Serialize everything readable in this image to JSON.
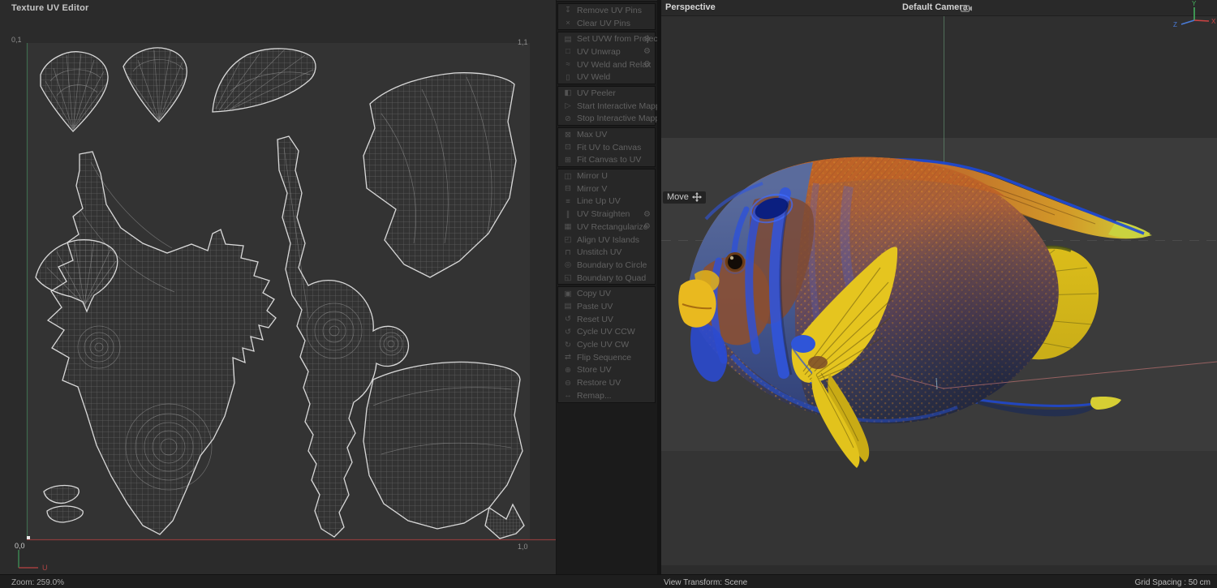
{
  "app": {
    "status_bar": {
      "zoom": "Zoom: 259.0%",
      "view_transform": "View Transform: Scene",
      "grid_spacing": "Grid Spacing : 50 cm"
    }
  },
  "uv_editor": {
    "title": "Texture UV Editor",
    "corners": {
      "top_left": "0,1",
      "top_right": "1,1",
      "bottom_left": "0,0",
      "bottom_right": "1,0"
    },
    "u_axis_label": "U"
  },
  "uv_menu": {
    "groups": [
      {
        "items": [
          {
            "label": "Remove UV Pins",
            "icon": "pin-icon"
          },
          {
            "label": "Clear UV Pins",
            "icon": "clear-pins-icon"
          }
        ]
      },
      {
        "items": [
          {
            "label": "Set UVW from Projection",
            "icon": "projection-icon",
            "gear": true
          },
          {
            "label": "UV Unwrap",
            "icon": "unwrap-icon",
            "gear": true
          },
          {
            "label": "UV Weld and Relax",
            "icon": "weld-relax-icon",
            "gear": true
          },
          {
            "label": "UV Weld",
            "icon": "weld-icon"
          }
        ]
      },
      {
        "items": [
          {
            "label": "UV Peeler",
            "icon": "peeler-icon"
          },
          {
            "label": "Start Interactive Mapping",
            "icon": "play-icon"
          },
          {
            "label": "Stop Interactive Mapping",
            "icon": "stop-icon"
          }
        ]
      },
      {
        "items": [
          {
            "label": "Max UV",
            "icon": "max-uv-icon"
          },
          {
            "label": "Fit UV to Canvas",
            "icon": "fit-uv-icon"
          },
          {
            "label": "Fit Canvas to UV",
            "icon": "fit-canvas-icon"
          }
        ]
      },
      {
        "items": [
          {
            "label": "Mirror U",
            "icon": "mirror-u-icon"
          },
          {
            "label": "Mirror V",
            "icon": "mirror-v-icon"
          },
          {
            "label": "Line Up UV",
            "icon": "line-up-icon"
          },
          {
            "label": "UV Straighten",
            "icon": "straighten-icon",
            "gear": true
          },
          {
            "label": "UV Rectangularize",
            "icon": "rectangularize-icon",
            "gear": true
          },
          {
            "label": "Align UV Islands",
            "icon": "align-islands-icon"
          },
          {
            "label": "Unstitch UV",
            "icon": "unstitch-icon"
          },
          {
            "label": "Boundary to Circle",
            "icon": "boundary-circle-icon"
          },
          {
            "label": "Boundary to Quad",
            "icon": "boundary-quad-icon"
          }
        ]
      },
      {
        "items": [
          {
            "label": "Copy UV",
            "icon": "copy-icon"
          },
          {
            "label": "Paste UV",
            "icon": "paste-icon"
          },
          {
            "label": "Reset UV",
            "icon": "reset-icon"
          },
          {
            "label": "Cycle UV CCW",
            "icon": "cycle-ccw-icon"
          },
          {
            "label": "Cycle UV CW",
            "icon": "cycle-cw-icon"
          },
          {
            "label": "Flip Sequence",
            "icon": "flip-icon"
          },
          {
            "label": "Store UV",
            "icon": "store-icon"
          },
          {
            "label": "Restore UV",
            "icon": "restore-icon"
          },
          {
            "label": "Remap...",
            "icon": "remap-icon"
          }
        ]
      }
    ]
  },
  "viewport": {
    "view_label": "Perspective",
    "camera_label": "Default Camera",
    "tool_label": "Move",
    "subject": "angelfish-3d-model",
    "gizmo": {
      "x": "X",
      "y": "Y",
      "z": "Z"
    }
  },
  "colors": {
    "axis_x": "#cd4444",
    "axis_y": "#44b05c",
    "axis_z": "#4a7bd8",
    "uv_u_axis": "#8a3c3c",
    "uv_v_axis": "#3f6b4f",
    "work_plane_axis": "#bd7272"
  }
}
